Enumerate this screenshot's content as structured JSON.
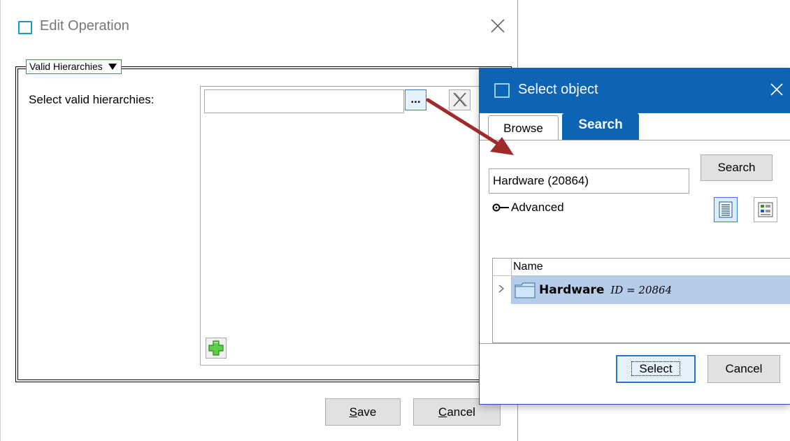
{
  "edit_dialog": {
    "title": "Edit Operation",
    "group_label": "Valid Hierarchies",
    "hierarchies_label": "Select valid hierarchies:",
    "hierarchies_value": "",
    "browse_label": "...",
    "save_label_u": "S",
    "save_label_rest": "ave",
    "cancel_label_u": "C",
    "cancel_label_rest": "ancel"
  },
  "select_dialog": {
    "title": "Select object",
    "tabs": [
      {
        "label": "Browse",
        "active": false
      },
      {
        "label": "Search",
        "active": true
      }
    ],
    "search_value": "Hardware (20864)",
    "search_button": "Search",
    "advanced_label": "Advanced",
    "results": {
      "columns": [
        "Name"
      ],
      "rows": [
        {
          "name": "Hardware",
          "id_text": "ID = 20864",
          "selected": true
        }
      ]
    },
    "select_button": "Select",
    "cancel_button": "Cancel"
  },
  "colors": {
    "titlebar": "#0d63b4",
    "selected_row": "#b5cdea",
    "arrow": "#a12a2a",
    "accent": "#1a97c9"
  }
}
